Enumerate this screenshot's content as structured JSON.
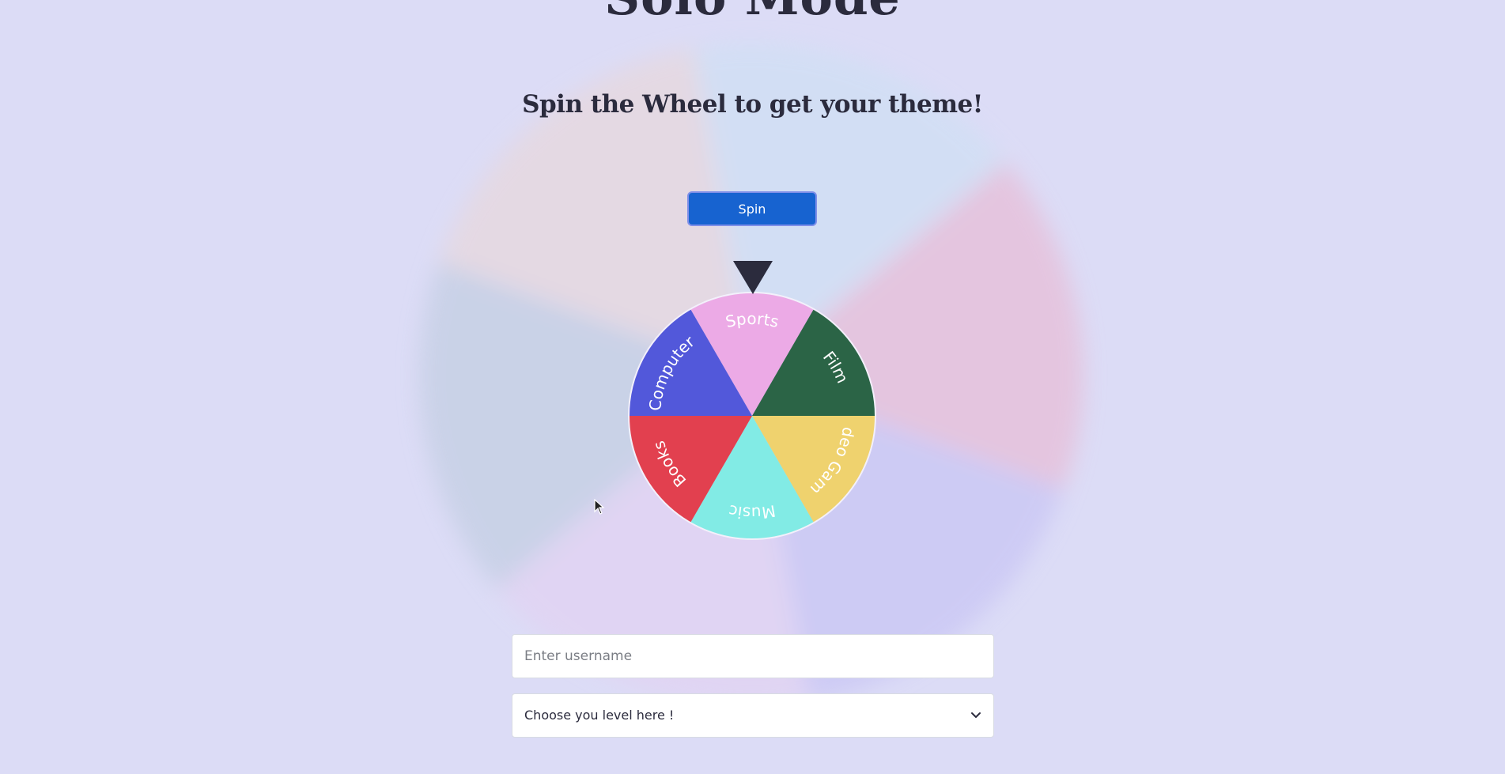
{
  "page": {
    "title": "Solo Mode",
    "subtitle": "Spin the Wheel to get your theme!"
  },
  "spin": {
    "label": "Spin",
    "color": "#1763d0"
  },
  "wheel": {
    "pointer_color": "#2b2b3d",
    "segments": [
      {
        "label": "Sports",
        "color": "#ecaae6"
      },
      {
        "label": "Film",
        "color": "#2b6446"
      },
      {
        "label": "Video Games",
        "color": "#efd26e"
      },
      {
        "label": "Music",
        "color": "#82ebe5"
      },
      {
        "label": "Books",
        "color": "#e2404f"
      },
      {
        "label": "Computers",
        "color": "#5258da"
      }
    ]
  },
  "background_wheel_colors": [
    "#e8d8dc",
    "#cfe0f4",
    "#e8bcd6",
    "#c8c4f4",
    "#e2d2f2",
    "#c2cee2"
  ],
  "form": {
    "username_placeholder": "Enter username",
    "username_value": "",
    "level_selected": "Choose you level here !"
  },
  "icons": {
    "pointer": "triangle-down-icon",
    "chevron": "chevron-down-icon",
    "cursor": "mouse-cursor-icon"
  }
}
